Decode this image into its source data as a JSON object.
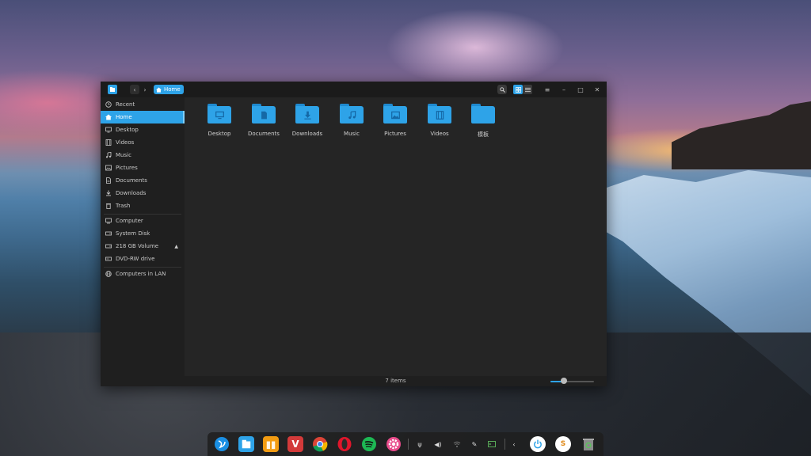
{
  "window": {
    "breadcrumb": "Home",
    "status": "7 items",
    "zoom_level": 0.3
  },
  "sidebar": {
    "items": [
      {
        "label": "Recent",
        "icon": "clock-icon"
      },
      {
        "label": "Home",
        "icon": "home-icon",
        "active": true
      },
      {
        "label": "Desktop",
        "icon": "monitor-icon"
      },
      {
        "label": "Videos",
        "icon": "film-icon"
      },
      {
        "label": "Music",
        "icon": "music-icon"
      },
      {
        "label": "Pictures",
        "icon": "image-icon"
      },
      {
        "label": "Documents",
        "icon": "document-icon"
      },
      {
        "label": "Downloads",
        "icon": "download-icon"
      },
      {
        "label": "Trash",
        "icon": "trash-icon"
      },
      {
        "label": "Computer",
        "icon": "computer-icon"
      },
      {
        "label": "System Disk",
        "icon": "disk-icon"
      },
      {
        "label": "218 GB Volume",
        "icon": "disk-icon"
      },
      {
        "label": "DVD-RW drive",
        "icon": "optical-drive-icon"
      },
      {
        "label": "Computers in LAN",
        "icon": "network-icon"
      }
    ]
  },
  "folders": [
    {
      "label": "Desktop",
      "icon": "monitor-icon"
    },
    {
      "label": "Documents",
      "icon": "document-icon"
    },
    {
      "label": "Downloads",
      "icon": "download-icon"
    },
    {
      "label": "Music",
      "icon": "music-icon"
    },
    {
      "label": "Pictures",
      "icon": "image-icon"
    },
    {
      "label": "Videos",
      "icon": "film-icon"
    },
    {
      "label": "模板",
      "icon": "template-icon"
    }
  ],
  "colors": {
    "accent": "#2ea3e8",
    "window_bg": "#252525",
    "sidebar_bg": "#1f1f1f",
    "titlebar_bg": "#1b1b1b"
  },
  "dock": {
    "apps": [
      "launcher-icon",
      "file-manager-icon",
      "app-store-icon",
      "vivaldi-icon",
      "chrome-icon",
      "opera-icon",
      "spotify-icon",
      "settings-icon"
    ],
    "tray": [
      "usb-icon",
      "volume-icon",
      "wifi-icon",
      "pen-icon",
      "terminal-icon",
      "chevron-left-icon",
      "power-icon",
      "input-method-icon",
      "trash-icon"
    ]
  }
}
